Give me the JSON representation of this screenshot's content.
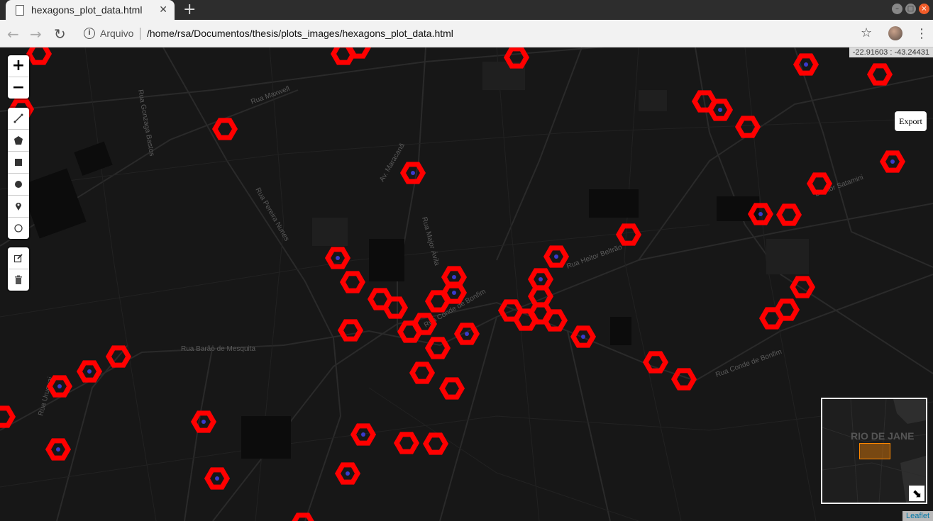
{
  "browser": {
    "tab_title": "hexagons_plot_data.html",
    "tab_close": "✕",
    "new_tab": "+",
    "site_label": "Arquivo",
    "url": "/home/rsa/Documentos/thesis/plots_images/hexagons_plot_data.html"
  },
  "map": {
    "coordinates": "-22.91603 : -43.24431",
    "export_label": "Export",
    "attribution": "Leaflet",
    "zoom_in": "+",
    "zoom_out": "−",
    "minimap_label": "RIO DE JANE",
    "minimap_toggle": "⬊",
    "hexagon_color": "#ff0000",
    "center_color": "#3a3acc",
    "street_labels": [
      "Rua Maxwell",
      "Rua Barão de Mesquita",
      "Rua Pereira Nunes",
      "Rua Major Ávila",
      "Rua Conde de Bonfim",
      "Doutor Satamini",
      "Rua Heitor Beltrão",
      "Av. Maracanã",
      "Rua Gonzaga Bastos",
      "Rua Uruguai",
      "Rua Conde de Bonfim"
    ]
  }
}
